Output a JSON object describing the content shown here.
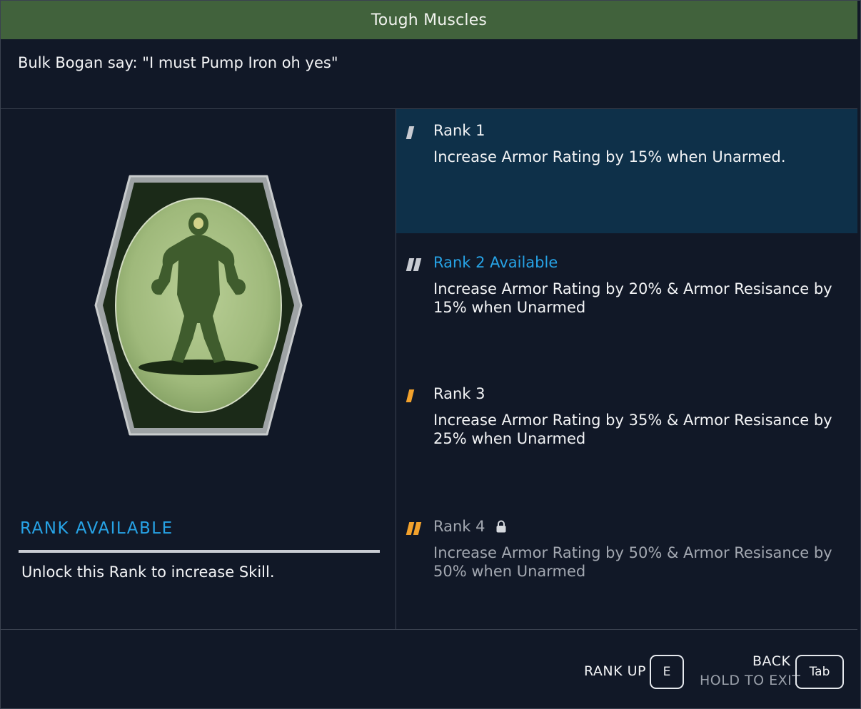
{
  "title": "Tough Muscles",
  "quote": "Bulk Bogan say: \"I must Pump Iron oh yes\"",
  "badge_icon": "bodybuilder-badge-icon",
  "status": {
    "heading": "RANK AVAILABLE",
    "description": "Unlock this Rank to increase Skill."
  },
  "ranks": [
    {
      "title": "Rank 1",
      "description": "Increase Armor Rating by 15% when Unarmed.",
      "bars": 1,
      "color": "#c8cbd2",
      "locked": false,
      "selected": true
    },
    {
      "title": "Rank 2 Available",
      "description": "Increase Armor Rating by 20% & Armor Resisance by 15% when Unarmed",
      "bars": 2,
      "color": "#c8cbd2",
      "title_color": "#27a3e6",
      "locked": false,
      "selected": false
    },
    {
      "title": "Rank 3",
      "description": "Increase Armor Rating by 35% & Armor Resisance by 25% when Unarmed",
      "bars": 1,
      "color": "#f2a12c",
      "locked": false,
      "selected": false
    },
    {
      "title": "Rank 4",
      "description": "Increase Armor Rating by 50% & Armor Resisance by 50% when Unarmed",
      "bars": 2,
      "color": "#f2a12c",
      "locked": true,
      "selected": false,
      "icon": "lock-icon"
    }
  ],
  "footer": {
    "rank_up_label": "RANK UP",
    "rank_up_key": "E",
    "back_label": "BACK",
    "hold_label": "HOLD TO EXIT",
    "back_key": "Tab"
  },
  "colors": {
    "accent_blue": "#27a3e6",
    "accent_orange": "#f2a12c",
    "title_bar": "#41623c",
    "selected_row": "#0e3049"
  }
}
